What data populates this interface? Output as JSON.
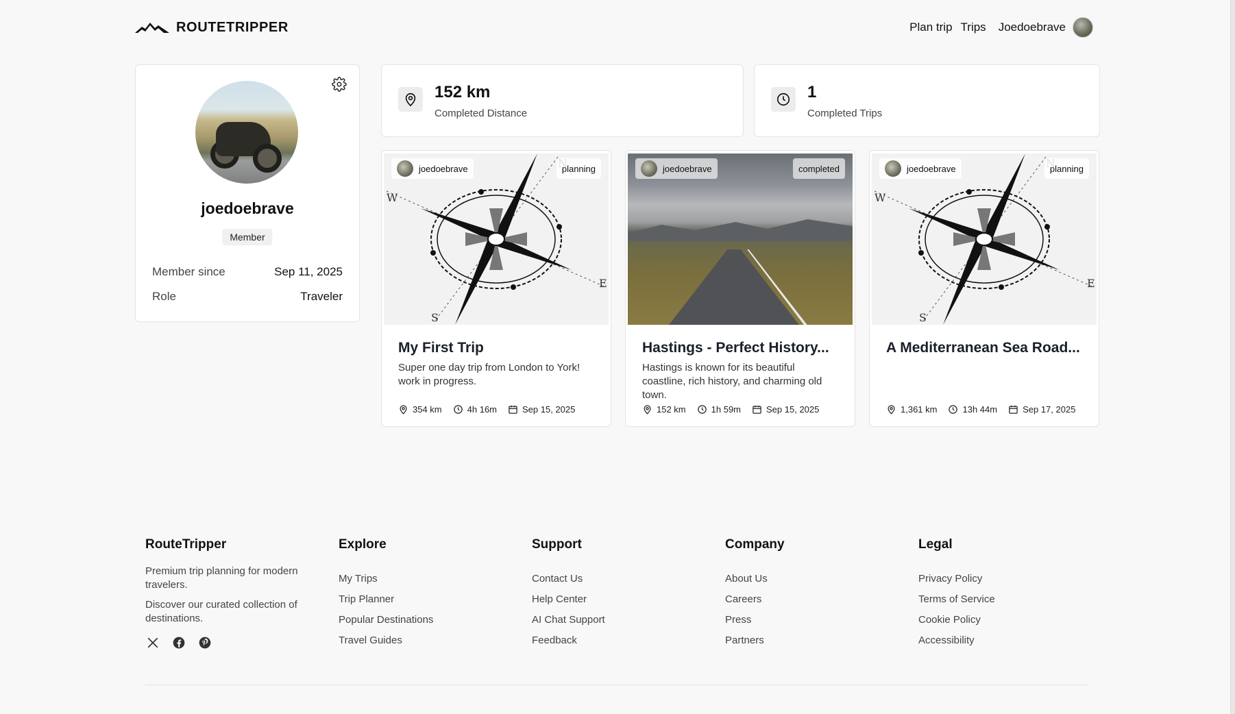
{
  "header": {
    "brand": "ROUTETRIPPER",
    "nav": {
      "plan": "Plan trip",
      "trips": "Trips"
    },
    "username": "Joedoebrave"
  },
  "profile": {
    "name": "joedoebrave",
    "badge": "Member",
    "rows": [
      {
        "key": "Member since",
        "value": "Sep 11, 2025"
      },
      {
        "key": "Role",
        "value": "Traveler"
      }
    ]
  },
  "stats": [
    {
      "value": "152 km",
      "label": "Completed Distance",
      "icon": "map-pin-icon"
    },
    {
      "value": "1",
      "label": "Completed Trips",
      "icon": "clock-icon"
    }
  ],
  "trips": [
    {
      "user": "joedoebrave",
      "status": "planning",
      "title": "My First Trip",
      "desc": "Super one day trip from London to York! work in progress.",
      "distance": "354 km",
      "duration": "4h 16m",
      "date": "Sep 15, 2025",
      "image": "compass"
    },
    {
      "user": "joedoebrave",
      "status": "completed",
      "title": "Hastings - Perfect History...",
      "desc": "Hastings is known for its beautiful coastline, rich history, and charming old town.",
      "distance": "152 km",
      "duration": "1h 59m",
      "date": "Sep 15, 2025",
      "image": "road"
    },
    {
      "user": "joedoebrave",
      "status": "planning",
      "title": "A Mediterranean Sea Road...",
      "desc": "",
      "distance": "1,361 km",
      "duration": "13h 44m",
      "date": "Sep 17, 2025",
      "image": "compass"
    }
  ],
  "footer": {
    "brand": {
      "title": "RouteTripper",
      "tagline": "Premium trip planning for modern travelers.",
      "text": "Discover our curated collection of destinations.",
      "socials": [
        "x-icon",
        "facebook-icon",
        "pinterest-icon"
      ]
    },
    "explore": {
      "title": "Explore",
      "links": [
        "My Trips",
        "Trip Planner",
        "Popular Destinations",
        "Travel Guides"
      ]
    },
    "support": {
      "title": "Support",
      "links": [
        "Contact Us",
        "Help Center",
        "AI Chat Support",
        "Feedback"
      ]
    },
    "company": {
      "title": "Company",
      "links": [
        "About Us",
        "Careers",
        "Press",
        "Partners"
      ]
    },
    "legal": {
      "title": "Legal",
      "links": [
        "Privacy Policy",
        "Terms of Service",
        "Cookie Policy",
        "Accessibility"
      ]
    }
  }
}
